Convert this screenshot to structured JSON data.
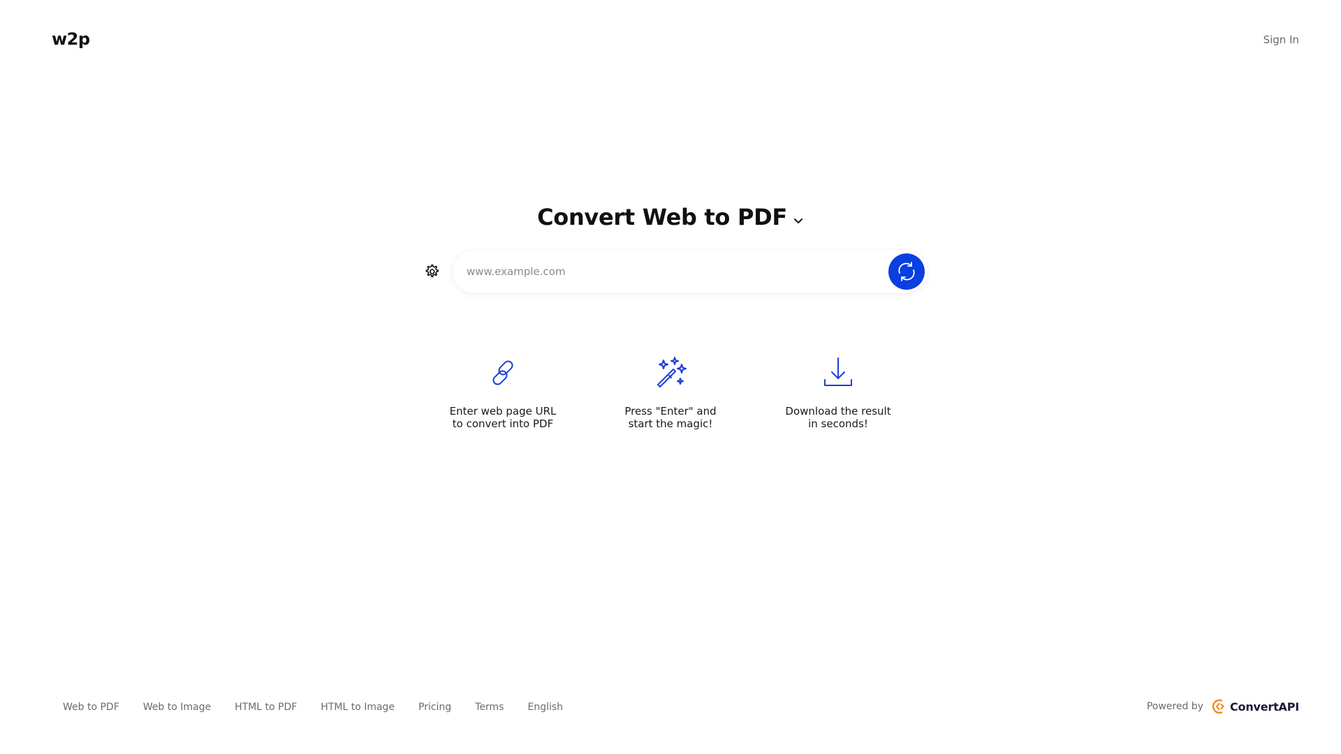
{
  "header": {
    "logo": "w2p",
    "sign_in": "Sign In"
  },
  "hero": {
    "title": "Convert Web to PDF"
  },
  "search": {
    "placeholder": "www.example.com",
    "value": ""
  },
  "steps": [
    {
      "icon": "link-icon",
      "text": "Enter web page URL to convert into PDF"
    },
    {
      "icon": "magic-wand-icon",
      "text": "Press \"Enter\" and start the magic!"
    },
    {
      "icon": "download-icon",
      "text": "Download the result in seconds!"
    }
  ],
  "footer": {
    "links": [
      "Web to PDF",
      "Web to Image",
      "HTML to PDF",
      "HTML to Image",
      "Pricing",
      "Terms",
      "English"
    ],
    "powered_by": "Powered by",
    "brand": "ConvertAPI"
  },
  "colors": {
    "accent": "#0a3fe0",
    "icon_blue": "#1b3fd6",
    "brand_orange": "#f28a1e",
    "muted_text": "#6b6b6b"
  }
}
